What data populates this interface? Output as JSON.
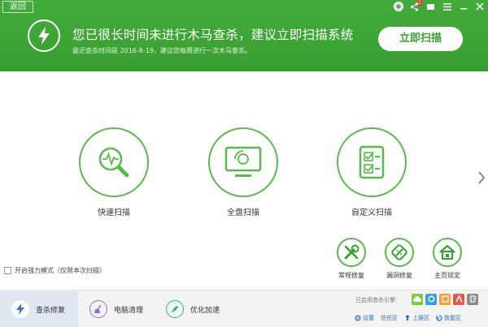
{
  "header": {
    "back_label": "返回",
    "title": "您已很长时间未进行木马查杀，建议立即扫描系统",
    "subtitle": "最近查杀时间是 2016-8-19，建议您每周进行一次木马查杀。",
    "scan_now_label": "立即扫描",
    "notify_count": "1"
  },
  "scan_options": [
    {
      "label": "快速扫描"
    },
    {
      "label": "全盘扫描"
    },
    {
      "label": "自定义扫描"
    }
  ],
  "repair_options": [
    {
      "label": "常规修复"
    },
    {
      "label": "漏洞修复"
    },
    {
      "label": "主页锁定"
    }
  ],
  "power_mode_label": "开启强力模式（仅限本次扫描）",
  "footer": {
    "tabs": [
      {
        "label": "查杀修复",
        "active": true
      },
      {
        "label": "电脑清理",
        "active": false
      },
      {
        "label": "优化加速",
        "active": false
      }
    ],
    "engine_label": "已启用查杀引擎：",
    "links": [
      {
        "label": "设置"
      },
      {
        "label": "信任区"
      },
      {
        "label": "上报区"
      },
      {
        "label": "恢复区"
      }
    ]
  },
  "colors": {
    "brand_green": "#3a9e32",
    "ring_green": "#5bb84f",
    "tab_active_bg": "#dfe8f1"
  }
}
